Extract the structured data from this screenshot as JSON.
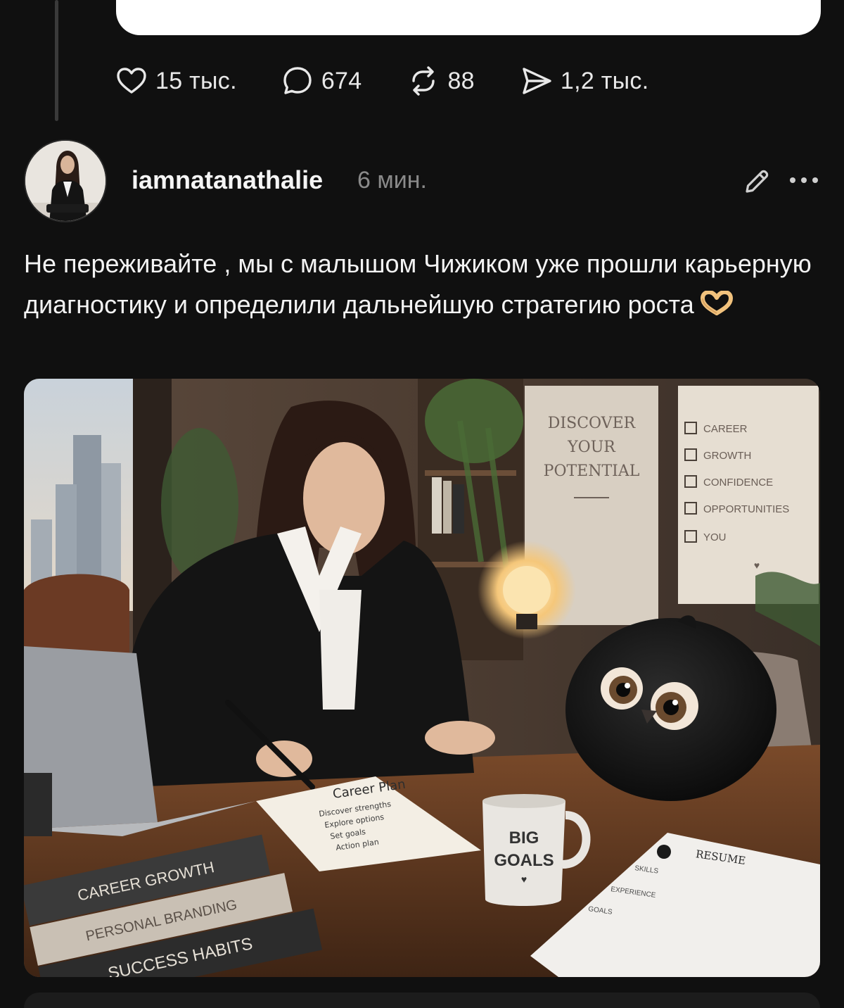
{
  "previous_post": {
    "stats": {
      "likes": "15 тыс.",
      "comments": "674",
      "reposts": "88",
      "shares": "1,2 тыс."
    }
  },
  "post": {
    "username": "iamnatanathalie",
    "time": "6 мин.",
    "text": "Не переживайте , мы с малышом Чижиком уже прошли карьерную диагностику и определили дальнейшую стратегию роста",
    "emoji_icon": "heart-hands-emoji",
    "image": {
      "poster_left": [
        "DISCOVER",
        "YOUR",
        "POTENTIAL"
      ],
      "poster_right": [
        "CAREER",
        "GROWTH",
        "CONFIDENCE",
        "OPPORTUNITIES",
        "YOU"
      ],
      "notebook_title": "Career Plan",
      "notebook_items": [
        "Discover strengths",
        "Explore options",
        "Set goals",
        "Action plan"
      ],
      "mug_text": [
        "BIG",
        "GOALS"
      ],
      "books": [
        "CAREER GROWTH",
        "PERSONAL BRANDING",
        "SUCCESS HABITS"
      ],
      "resume_title": "RESUME",
      "resume_sections": [
        "SKILLS",
        "EXPERIENCE",
        "GOALS"
      ]
    }
  },
  "colors": {
    "background": "#101010",
    "text": "#f3f3f3",
    "muted": "#8a8a8a",
    "icon": "#e8e8e8"
  }
}
